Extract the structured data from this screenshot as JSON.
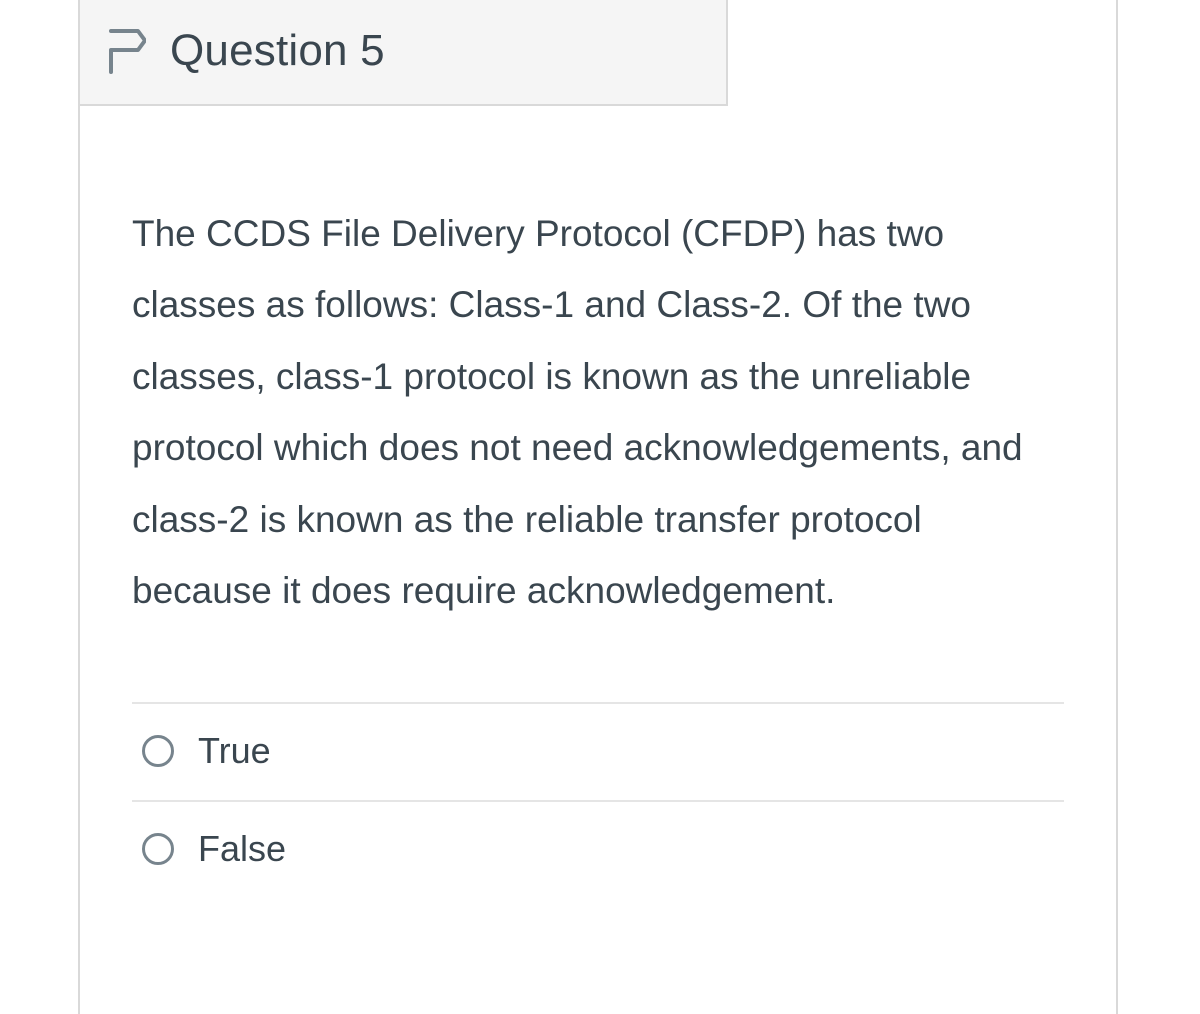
{
  "question": {
    "title": "Question 5",
    "text": "The CCDS File Delivery Protocol (CFDP) has two classes as follows: Class-1 and Class-2. Of the two classes, class-1 protocol is known as the unreliable protocol which does not need acknowledgements, and class-2 is known as the reliable transfer protocol because it does require acknowledgement.",
    "options": [
      {
        "label": "True"
      },
      {
        "label": "False"
      }
    ]
  }
}
